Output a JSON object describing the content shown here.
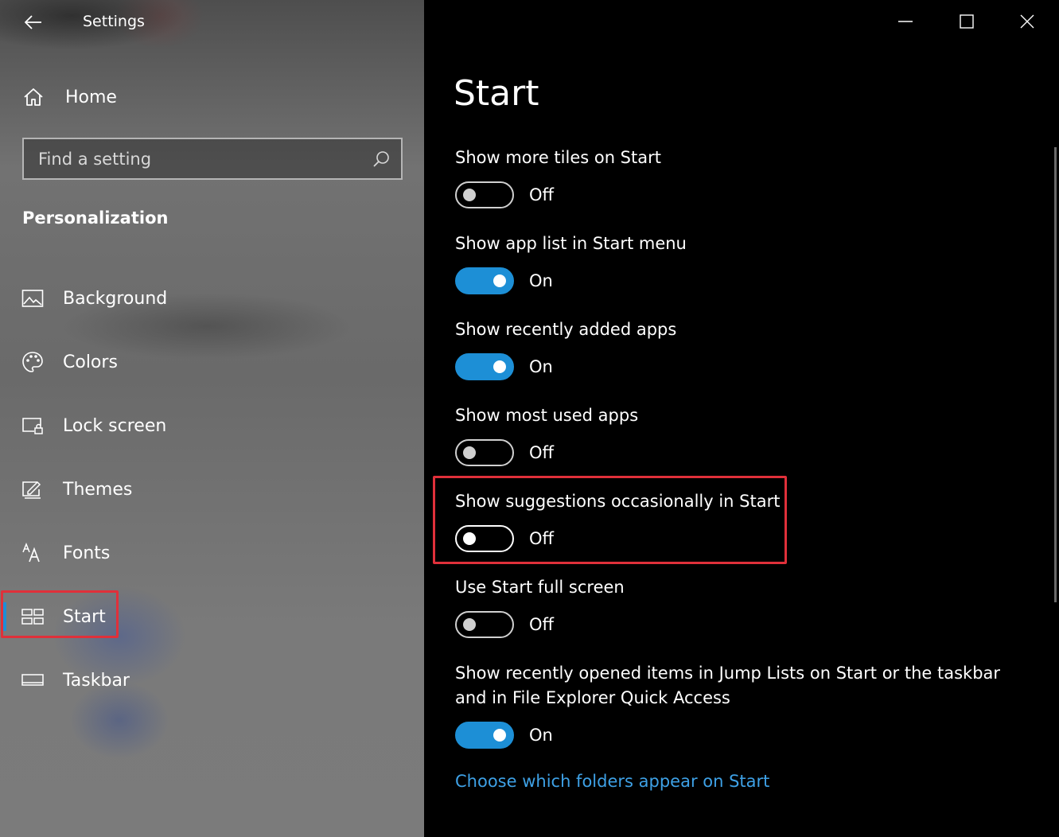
{
  "window": {
    "title": "Settings"
  },
  "sidebar": {
    "home_label": "Home",
    "search_placeholder": "Find a setting",
    "section_title": "Personalization",
    "items": [
      {
        "label": "Background",
        "icon": "picture-icon"
      },
      {
        "label": "Colors",
        "icon": "palette-icon"
      },
      {
        "label": "Lock screen",
        "icon": "lock-screen-icon"
      },
      {
        "label": "Themes",
        "icon": "themes-brush-icon"
      },
      {
        "label": "Fonts",
        "icon": "fonts-icon"
      },
      {
        "label": "Start",
        "icon": "start-tiles-icon",
        "active": true
      },
      {
        "label": "Taskbar",
        "icon": "taskbar-icon"
      }
    ]
  },
  "main": {
    "title": "Start",
    "settings": [
      {
        "label": "Show more tiles on Start",
        "state": "Off"
      },
      {
        "label": "Show app list in Start menu",
        "state": "On"
      },
      {
        "label": "Show recently added apps",
        "state": "On"
      },
      {
        "label": "Show most used apps",
        "state": "Off"
      },
      {
        "label": "Show suggestions occasionally in Start",
        "state": "Off"
      },
      {
        "label": "Use Start full screen",
        "state": "Off"
      },
      {
        "label": "Show recently opened items in Jump Lists on Start or the taskbar and in File Explorer Quick Access",
        "state": "On"
      }
    ],
    "link": "Choose which folders appear on Start"
  },
  "colors": {
    "accent": "#1d8fd6",
    "highlight": "#e0303a",
    "link": "#3ea1e6"
  }
}
